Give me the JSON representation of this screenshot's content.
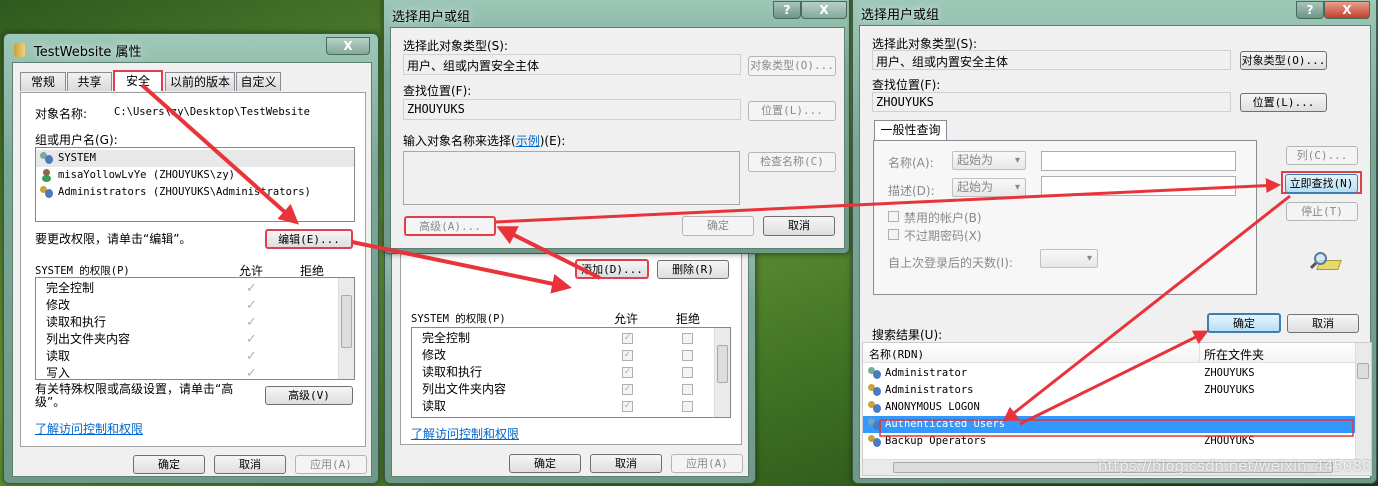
{
  "props_dialog": {
    "title": "TestWebsite 属性",
    "close_label": "X",
    "tabs": [
      "常规",
      "共享",
      "安全",
      "以前的版本",
      "自定义"
    ],
    "object_name_label": "对象名称:",
    "object_name_value": "C:\\Users\\zy\\Desktop\\TestWebsite",
    "group_label": "组或用户名(G):",
    "users": [
      "SYSTEM",
      "misaYollowLvYe (ZHOUYUKS\\zy)",
      "Administrators (ZHOUYUKS\\Administrators)"
    ],
    "edit_hint": "要更改权限，请单击“编辑”。",
    "edit_button": "编辑(E)...",
    "perm_title": "SYSTEM 的权限(P)",
    "allow_header": "允许",
    "deny_header": "拒绝",
    "permissions": [
      "完全控制",
      "修改",
      "读取和执行",
      "列出文件夹内容",
      "读取",
      "写入"
    ],
    "advanced_hint": "有关特殊权限或高级设置，请单击“高级”。",
    "advanced_button": "高级(V)",
    "learn_link": "了解访问控制和权限",
    "ok": "确定",
    "cancel": "取消",
    "apply": "应用(A)"
  },
  "props_dialog2": {
    "add_button": "添加(D)...",
    "remove_button": "删除(R)",
    "perm_title": "SYSTEM 的权限(P)",
    "allow_header": "允许",
    "deny_header": "拒绝",
    "permissions": [
      "完全控制",
      "修改",
      "读取和执行",
      "列出文件夹内容",
      "读取"
    ],
    "learn_link": "了解访问控制和权限",
    "ok": "确定",
    "cancel": "取消",
    "apply": "应用(A)"
  },
  "select_dialog": {
    "title": "选择用户或组",
    "help_label": "?",
    "close_label": "X",
    "object_type_label": "选择此对象类型(S):",
    "object_type_value": "用户、组或内置安全主体",
    "object_type_button": "对象类型(O)...",
    "location_label": "查找位置(F):",
    "location_value": "ZHOUYUKS",
    "location_button": "位置(L)...",
    "enter_label_pre": "输入对象名称来选择(",
    "enter_label_link": "示例",
    "enter_label_post": ")(E):",
    "check_names_button": "检查名称(C)",
    "advanced_button": "高级(A)...",
    "ok": "确定",
    "cancel": "取消"
  },
  "advanced_dialog": {
    "title": "选择用户或组",
    "help_label": "?",
    "close_label": "X",
    "object_type_label": "选择此对象类型(S):",
    "object_type_value": "用户、组或内置安全主体",
    "object_type_button": "对象类型(O)...",
    "location_label": "查找位置(F):",
    "location_value": "ZHOUYUKS",
    "location_button": "位置(L)...",
    "tab_label": "一般性查询",
    "name_label": "名称(A):",
    "desc_label": "描述(D):",
    "starts_with": "起始为",
    "disabled_accounts": "禁用的帐户(B)",
    "non_expiring": "不过期密码(X)",
    "days_label": "自上次登录后的天数(I):",
    "columns_button": "列(C)...",
    "find_now_button": "立即查找(N)",
    "stop_button": "停止(T)",
    "ok": "确定",
    "cancel": "取消",
    "results_label": "搜索结果(U):",
    "col_name": "名称(RDN)",
    "col_folder": "所在文件夹",
    "results": [
      {
        "name": "Administrator",
        "folder": "ZHOUYUKS"
      },
      {
        "name": "Administrators",
        "folder": "ZHOUYUKS"
      },
      {
        "name": "ANONYMOUS LOGON",
        "folder": ""
      },
      {
        "name": "Authenticated Users",
        "folder": ""
      },
      {
        "name": "Backup Operators",
        "folder": "ZHOUYUKS"
      }
    ],
    "watermark": "https://blog.csdn.net/weixin_44508087"
  },
  "colors": {
    "annotation": "#e8333a",
    "selection": "#3399ff",
    "link": "#0066cc"
  }
}
